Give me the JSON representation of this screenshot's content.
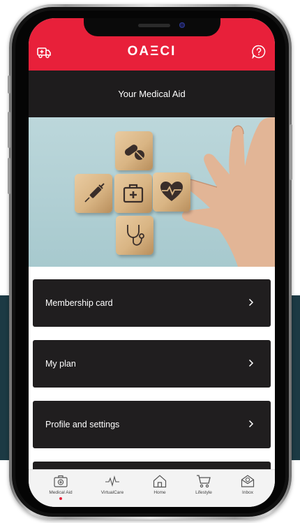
{
  "header": {
    "logo_text": "ОAΞCI",
    "left_icon": "ambulance-icon",
    "right_icon": "help-icon"
  },
  "page": {
    "title": "Your Medical Aid"
  },
  "menu": {
    "items": [
      {
        "label": "Membership card"
      },
      {
        "label": "My plan"
      },
      {
        "label": "Profile and settings"
      }
    ]
  },
  "tabbar": {
    "items": [
      {
        "label": "Medical Aid",
        "icon": "medical-kit-icon",
        "active": true
      },
      {
        "label": "VirtualCare",
        "icon": "pulse-icon",
        "active": false
      },
      {
        "label": "Home",
        "icon": "home-icon",
        "active": false
      },
      {
        "label": "Lifestyle",
        "icon": "cart-icon",
        "active": false
      },
      {
        "label": "Inbox",
        "icon": "inbox-icon",
        "active": false
      }
    ]
  },
  "colors": {
    "brand_red": "#e8203a",
    "dark": "#201e1f",
    "teal_bg": "#1c3a44"
  }
}
